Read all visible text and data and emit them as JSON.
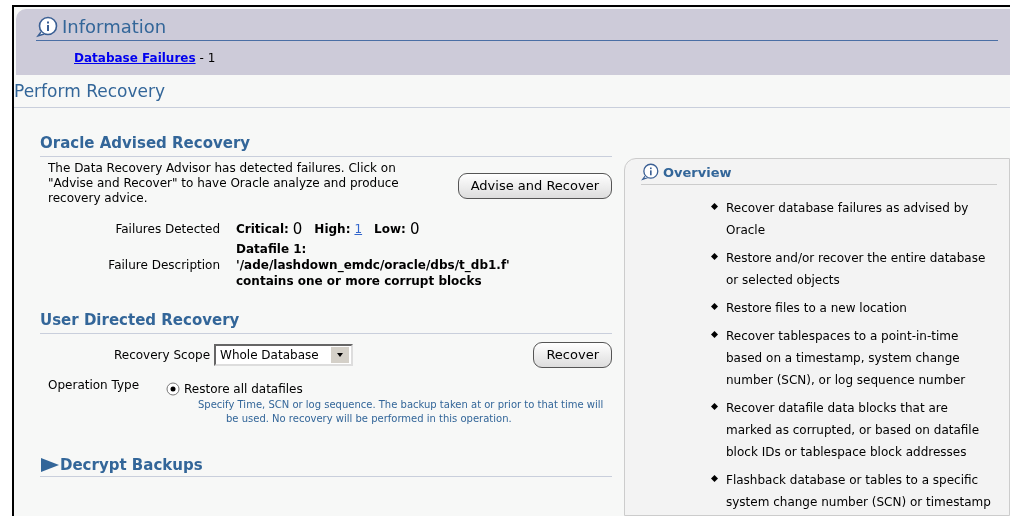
{
  "information": {
    "title": "Information",
    "link": "Database Failures",
    "count": "- 1"
  },
  "page_title": "Perform Recovery",
  "advised_recovery": {
    "title": "Oracle Advised Recovery",
    "description": "The Data Recovery Advisor has detected failures. Click on \"Advise and Recover\" to have Oracle analyze and produce recovery advice.",
    "button": "Advise and Recover",
    "failures_label": "Failures Detected",
    "critical_label": "Critical:",
    "critical": "0",
    "high_label": "High:",
    "high": "1",
    "low_label": "Low:",
    "low": "0",
    "description_label": "Failure Description",
    "failure_lines": [
      "Datafile 1:",
      "'/ade/lashdown_emdc/oracle/dbs/t_db1.f'",
      "contains one or more corrupt blocks"
    ]
  },
  "user_recovery": {
    "title": "User Directed Recovery",
    "scope_label": "Recovery Scope",
    "scope_value": "Whole Database",
    "button": "Recover",
    "operation_label": "Operation Type",
    "options": [
      {
        "label": "Restore all datafiles",
        "selected": true
      }
    ],
    "hint": "Specify Time, SCN or log sequence. The backup taken at or prior to that time will be used. No recovery will be performed in this operation."
  },
  "decrypt": {
    "title": "Decrypt Backups",
    "expanded": false
  },
  "overview": {
    "title": "Overview",
    "items": [
      "Recover database failures as advised by Oracle",
      "Restore and/or recover the entire database or selected objects",
      "Restore files to a new location",
      "Recover tablespaces to a point-in-time based on a timestamp, system change number (SCN), or log sequence number",
      "Recover datafile data blocks that are marked as corrupted, or based on datafile block IDs or tablespace block addresses",
      "Flashback database or tables to a specific system change number (SCN) or timestamp"
    ]
  }
}
